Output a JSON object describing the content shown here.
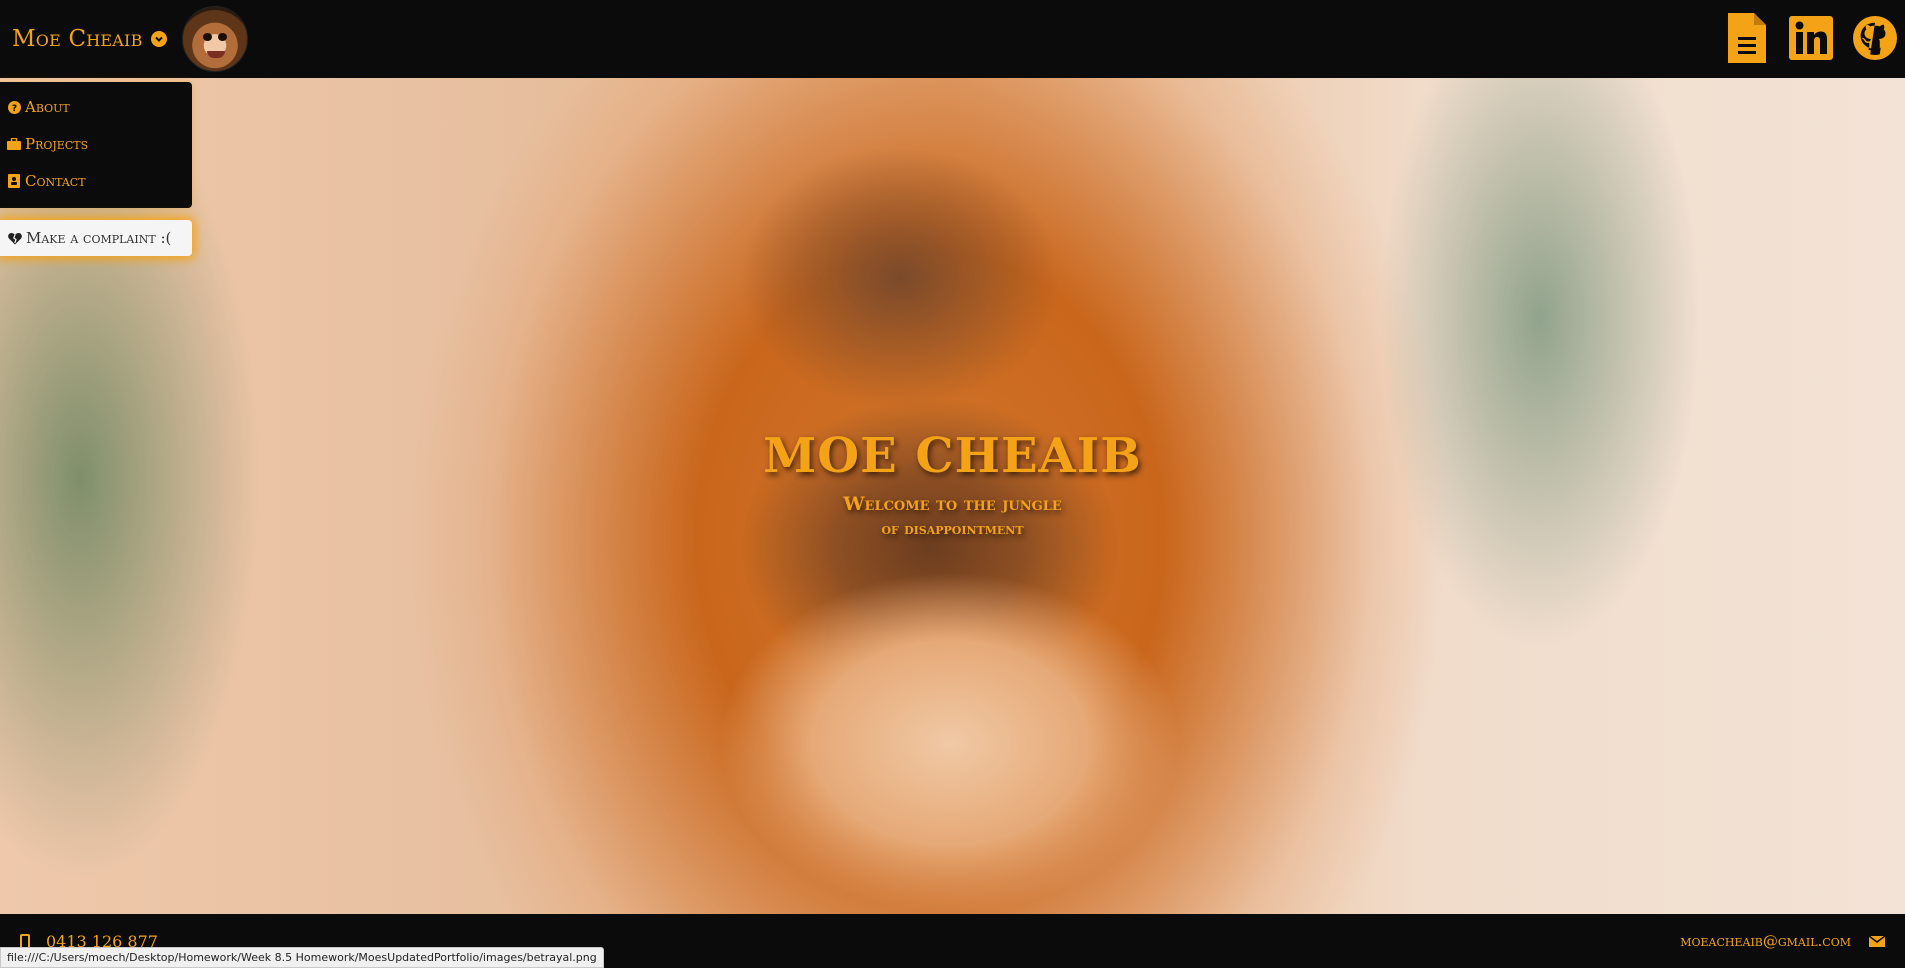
{
  "header": {
    "brand_name": "Moe Cheaib",
    "icons": [
      "resume-document-icon",
      "linkedin-icon",
      "github-icon"
    ]
  },
  "menu": {
    "items": [
      {
        "label": "About",
        "icon": "question-circle-icon"
      },
      {
        "label": "Projects",
        "icon": "briefcase-icon"
      },
      {
        "label": "Contact",
        "icon": "address-book-icon"
      }
    ],
    "complaint": {
      "label": "Make a complaint :(",
      "icon": "broken-heart-icon"
    }
  },
  "hero": {
    "title": "MOE CHEAIB",
    "subtitle_line1": "Welcome to the jungle",
    "subtitle_line2": "of disappointment"
  },
  "footer": {
    "phone": "0413 126 877",
    "email": "moeacheaib@gmail.com"
  },
  "status_bar": {
    "url": "file:///C:/Users/moech/Desktop/Homework/Week 8.5 Homework/MoesUpdatedPortfolio/images/betrayal.png"
  },
  "colors": {
    "accent": "#f5a316",
    "bar": "#0b0b0b"
  }
}
